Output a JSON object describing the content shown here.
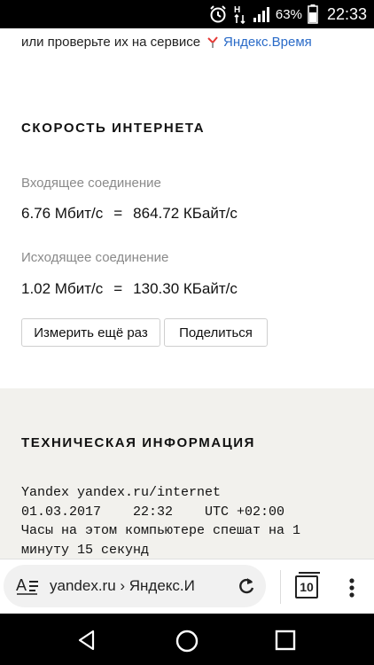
{
  "status_bar": {
    "battery_percent": "63%",
    "time": "22:33",
    "icons": [
      "alarm-icon",
      "hplus-data-icon",
      "signal-icon",
      "battery-icon"
    ]
  },
  "page": {
    "sync_text": "или проверьте их на сервисе",
    "yandex_time_link": "Яндекс.Время",
    "speed": {
      "title": "СКОРОСТЬ ИНТЕРНЕТА",
      "incoming_label": "Входящее соединение",
      "incoming_mbit": "6.76 Мбит/с",
      "incoming_kbyte": "864.72 КБайт/с",
      "outgoing_label": "Исходящее соединение",
      "outgoing_mbit": "1.02 Мбит/с",
      "outgoing_kbyte": "130.30 КБайт/с",
      "equals": "=",
      "measure_again_button": "Измерить ещё раз",
      "share_button": "Поделиться"
    },
    "tech": {
      "title": "ТЕХНИЧЕСКАЯ ИНФОРМАЦИЯ",
      "lines": [
        "Yandex yandex.ru/internet",
        "01.03.2017    22:32    UTC +02:00",
        "Часы на этом компьютере спешат на 1",
        "минуту 15 секунд"
      ]
    }
  },
  "browser_bar": {
    "url_text": "yandex.ru › Яндекс.И",
    "tab_count": "10"
  },
  "colors": {
    "link": "#2a6bc8",
    "muted": "#8a8a8a",
    "tech_bg": "#f2f1ed",
    "ytime_accent": "#e53935"
  }
}
